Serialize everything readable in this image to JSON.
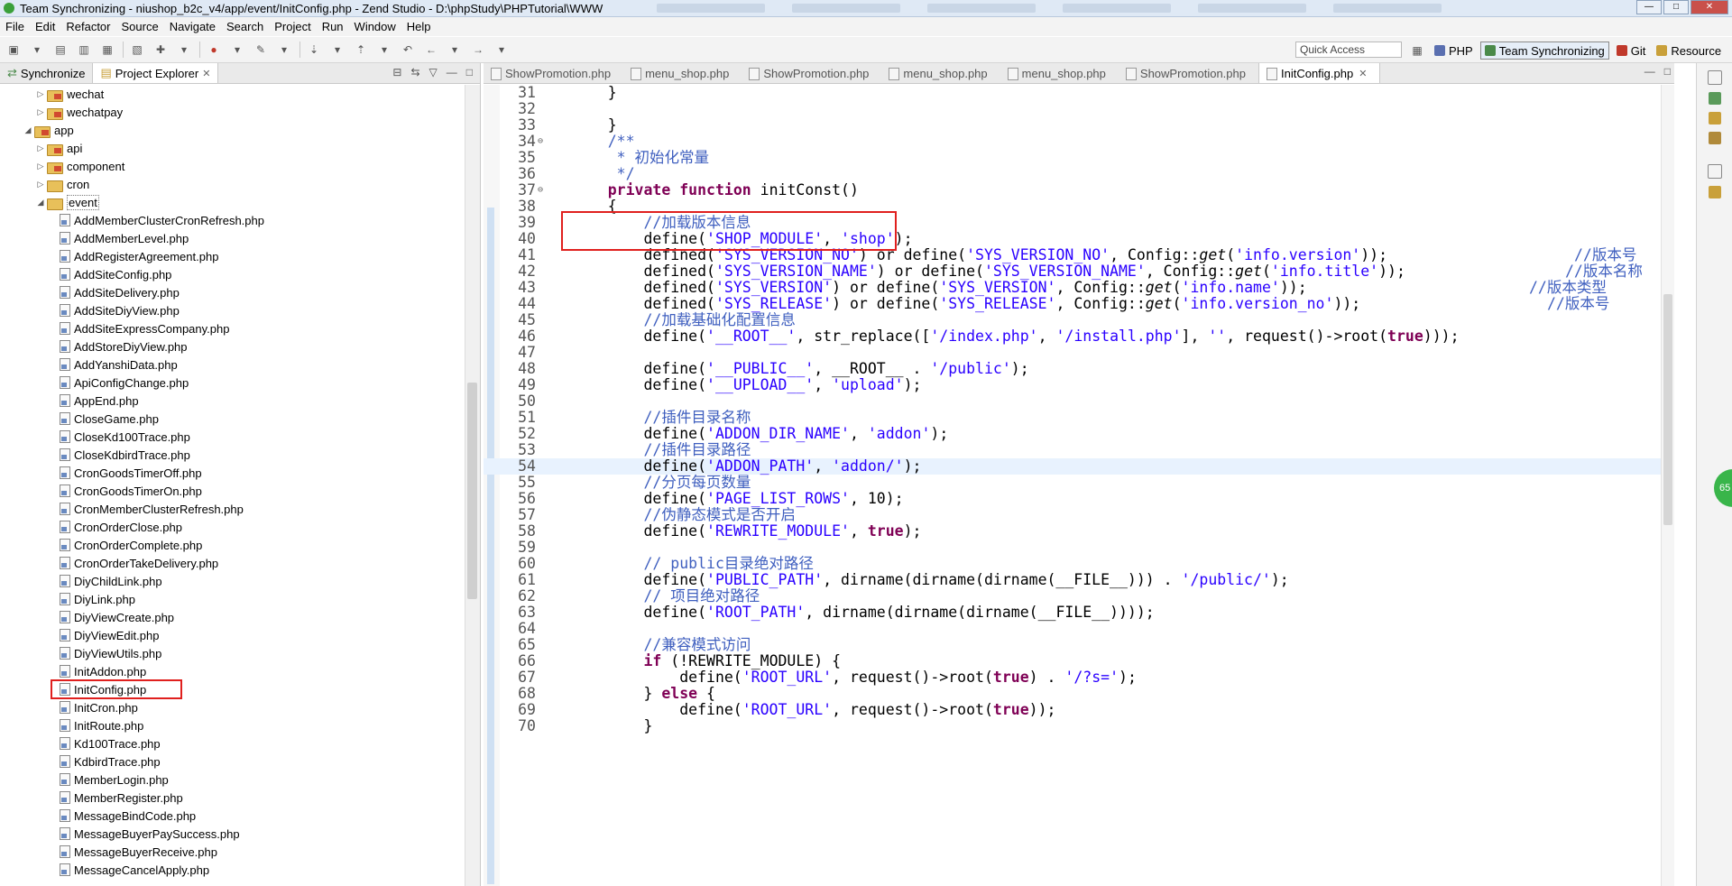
{
  "window": {
    "title": "Team Synchronizing - niushop_b2c_v4/app/event/InitConfig.php - Zend Studio - D:\\phpStudy\\PHPTutorial\\WWW",
    "controls": [
      "—",
      "□",
      "✕"
    ]
  },
  "menu": [
    "File",
    "Edit",
    "Refactor",
    "Source",
    "Navigate",
    "Search",
    "Project",
    "Run",
    "Window",
    "Help"
  ],
  "toolbar": {
    "quick_access": "Quick Access",
    "perspectives": [
      {
        "label": "PHP",
        "icon": "php-perspective-icon",
        "color": "#5a6fb0"
      },
      {
        "label": "Team Synchronizing",
        "icon": "sync-perspective-icon",
        "color": "#4a8a4a",
        "active": true
      },
      {
        "label": "Git",
        "icon": "git-perspective-icon",
        "color": "#c0392b"
      },
      {
        "label": "Resource",
        "icon": "resource-perspective-icon",
        "color": "#c9a03a"
      }
    ]
  },
  "left_panel": {
    "tabs": [
      {
        "label": "Synchronize",
        "active": false
      },
      {
        "label": "Project Explorer",
        "active": true,
        "close": "✕"
      }
    ],
    "tree": [
      {
        "label": "wechat",
        "type": "package",
        "depth": 3,
        "twisty": "▷"
      },
      {
        "label": "wechatpay",
        "type": "package",
        "depth": 3,
        "twisty": "▷"
      },
      {
        "label": "app",
        "type": "package",
        "depth": 2,
        "twisty": "◢"
      },
      {
        "label": "api",
        "type": "package",
        "depth": 3,
        "twisty": "▷"
      },
      {
        "label": "component",
        "type": "package",
        "depth": 3,
        "twisty": "▷"
      },
      {
        "label": "cron",
        "type": "folder",
        "depth": 3,
        "twisty": "▷"
      },
      {
        "label": "event",
        "type": "folder-open",
        "depth": 3,
        "twisty": "◢"
      },
      {
        "label": "AddMemberClusterCronRefresh.php",
        "type": "file",
        "depth": 4
      },
      {
        "label": "AddMemberLevel.php",
        "type": "file",
        "depth": 4
      },
      {
        "label": "AddRegisterAgreement.php",
        "type": "file",
        "depth": 4
      },
      {
        "label": "AddSiteConfig.php",
        "type": "file",
        "depth": 4
      },
      {
        "label": "AddSiteDelivery.php",
        "type": "file",
        "depth": 4
      },
      {
        "label": "AddSiteDiyView.php",
        "type": "file",
        "depth": 4
      },
      {
        "label": "AddSiteExpressCompany.php",
        "type": "file",
        "depth": 4
      },
      {
        "label": "AddStoreDiyView.php",
        "type": "file",
        "depth": 4
      },
      {
        "label": "AddYanshiData.php",
        "type": "file",
        "depth": 4
      },
      {
        "label": "ApiConfigChange.php",
        "type": "file",
        "depth": 4
      },
      {
        "label": "AppEnd.php",
        "type": "file",
        "depth": 4
      },
      {
        "label": "CloseGame.php",
        "type": "file",
        "depth": 4
      },
      {
        "label": "CloseKd100Trace.php",
        "type": "file",
        "depth": 4
      },
      {
        "label": "CloseKdbirdTrace.php",
        "type": "file",
        "depth": 4
      },
      {
        "label": "CronGoodsTimerOff.php",
        "type": "file",
        "depth": 4
      },
      {
        "label": "CronGoodsTimerOn.php",
        "type": "file",
        "depth": 4
      },
      {
        "label": "CronMemberClusterRefresh.php",
        "type": "file",
        "depth": 4
      },
      {
        "label": "CronOrderClose.php",
        "type": "file",
        "depth": 4
      },
      {
        "label": "CronOrderComplete.php",
        "type": "file",
        "depth": 4
      },
      {
        "label": "CronOrderTakeDelivery.php",
        "type": "file",
        "depth": 4
      },
      {
        "label": "DiyChildLink.php",
        "type": "file",
        "depth": 4
      },
      {
        "label": "DiyLink.php",
        "type": "file",
        "depth": 4
      },
      {
        "label": "DiyViewCreate.php",
        "type": "file",
        "depth": 4
      },
      {
        "label": "DiyViewEdit.php",
        "type": "file",
        "depth": 4
      },
      {
        "label": "DiyViewUtils.php",
        "type": "file",
        "depth": 4
      },
      {
        "label": "InitAddon.php",
        "type": "file",
        "depth": 4
      },
      {
        "label": "InitConfig.php",
        "type": "file",
        "depth": 4,
        "highlighted": true
      },
      {
        "label": "InitCron.php",
        "type": "file",
        "depth": 4
      },
      {
        "label": "InitRoute.php",
        "type": "file",
        "depth": 4
      },
      {
        "label": "Kd100Trace.php",
        "type": "file",
        "depth": 4
      },
      {
        "label": "KdbirdTrace.php",
        "type": "file",
        "depth": 4
      },
      {
        "label": "MemberLogin.php",
        "type": "file",
        "depth": 4
      },
      {
        "label": "MemberRegister.php",
        "type": "file",
        "depth": 4
      },
      {
        "label": "MessageBindCode.php",
        "type": "file",
        "depth": 4
      },
      {
        "label": "MessageBuyerPaySuccess.php",
        "type": "file",
        "depth": 4
      },
      {
        "label": "MessageBuyerReceive.php",
        "type": "file",
        "depth": 4
      },
      {
        "label": "MessageCancelApply.php",
        "type": "file",
        "depth": 4
      }
    ]
  },
  "editor": {
    "tabs": [
      {
        "label": "ShowPromotion.php"
      },
      {
        "label": "menu_shop.php"
      },
      {
        "label": "ShowPromotion.php"
      },
      {
        "label": "menu_shop.php"
      },
      {
        "label": "menu_shop.php"
      },
      {
        "label": "ShowPromotion.php"
      },
      {
        "label": "InitConfig.php",
        "active": true,
        "close": "✕"
      }
    ],
    "highlight_line": 54,
    "boxed_lines": [
      39,
      40
    ],
    "lines": [
      {
        "n": "31",
        "code": "    }"
      },
      {
        "n": "32",
        "code": ""
      },
      {
        "n": "33",
        "code": "    }"
      },
      {
        "n": "34",
        "code": "    /**",
        "fold": "⊖"
      },
      {
        "n": "35",
        "code": "     * 初始化常量"
      },
      {
        "n": "36",
        "code": "     */"
      },
      {
        "n": "37",
        "code": "    private function initConst()",
        "fold": "⊖"
      },
      {
        "n": "38",
        "code": "    {"
      },
      {
        "n": "39",
        "code": "        //加载版本信息"
      },
      {
        "n": "40",
        "code": "        define('SHOP_MODULE', 'shop');"
      },
      {
        "n": "41",
        "code": "        defined('SYS_VERSION_NO') or define('SYS_VERSION_NO', Config::get('info.version'));",
        "rc": "//版本号",
        "rcx": 1745
      },
      {
        "n": "42",
        "code": "        defined('SYS_VERSION_NAME') or define('SYS_VERSION_NAME', Config::get('info.title'));",
        "rc": "//版本名称",
        "rcx": 1735
      },
      {
        "n": "43",
        "code": "        defined('SYS_VERSION') or define('SYS_VERSION', Config::get('info.name'));",
        "rc": "//版本类型",
        "rcx": 1695
      },
      {
        "n": "44",
        "code": "        defined('SYS_RELEASE') or define('SYS_RELEASE', Config::get('info.version_no'));",
        "rc": "//版本号",
        "rcx": 1715
      },
      {
        "n": "45",
        "code": "        //加载基础化配置信息"
      },
      {
        "n": "46",
        "code": "        define('__ROOT__', str_replace(['/index.php', '/install.php'], '', request()->root(true)));"
      },
      {
        "n": "47",
        "code": ""
      },
      {
        "n": "48",
        "code": "        define('__PUBLIC__', __ROOT__ . '/public');"
      },
      {
        "n": "49",
        "code": "        define('__UPLOAD__', 'upload');"
      },
      {
        "n": "50",
        "code": ""
      },
      {
        "n": "51",
        "code": "        //插件目录名称"
      },
      {
        "n": "52",
        "code": "        define('ADDON_DIR_NAME', 'addon');"
      },
      {
        "n": "53",
        "code": "        //插件目录路径"
      },
      {
        "n": "54",
        "code": "        define('ADDON_PATH', 'addon/');"
      },
      {
        "n": "55",
        "code": "        //分页每页数量"
      },
      {
        "n": "56",
        "code": "        define('PAGE_LIST_ROWS', 10);"
      },
      {
        "n": "57",
        "code": "        //伪静态模式是否开启"
      },
      {
        "n": "58",
        "code": "        define('REWRITE_MODULE', true);"
      },
      {
        "n": "59",
        "code": ""
      },
      {
        "n": "60",
        "code": "        // public目录绝对路径"
      },
      {
        "n": "61",
        "code": "        define('PUBLIC_PATH', dirname(dirname(dirname(__FILE__))) . '/public/');"
      },
      {
        "n": "62",
        "code": "        // 项目绝对路径"
      },
      {
        "n": "63",
        "code": "        define('ROOT_PATH', dirname(dirname(dirname(__FILE__))));"
      },
      {
        "n": "64",
        "code": ""
      },
      {
        "n": "65",
        "code": "        //兼容模式访问"
      },
      {
        "n": "66",
        "code": "        if (!REWRITE_MODULE) {"
      },
      {
        "n": "67",
        "code": "            define('ROOT_URL', request()->root(true) . '/?s=');"
      },
      {
        "n": "68",
        "code": "        } else {"
      },
      {
        "n": "69",
        "code": "            define('ROOT_URL', request()->root(true));"
      },
      {
        "n": "70",
        "code": "        }"
      }
    ]
  },
  "side_badge": "65"
}
